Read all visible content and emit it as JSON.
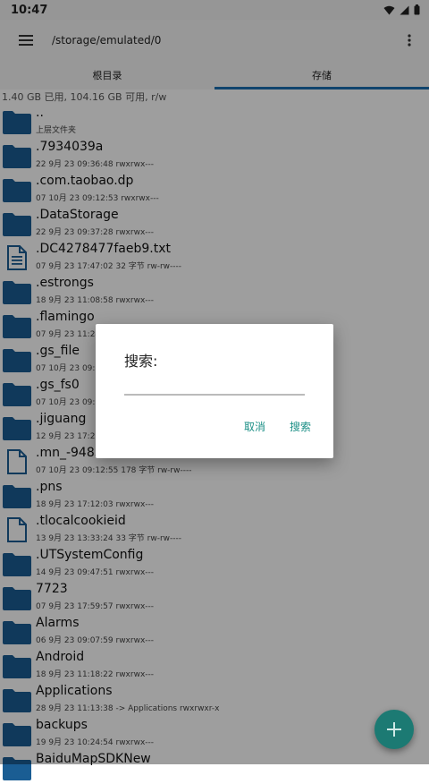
{
  "status_bar": {
    "time": "10:47"
  },
  "app_bar": {
    "path": "/storage/emulated/0"
  },
  "tabs": [
    {
      "label": "根目录",
      "active": false
    },
    {
      "label": "存储",
      "active": true
    }
  ],
  "storage_info": "1.40 GB 已用, 104.16 GB 可用, r/w",
  "files": [
    {
      "name": "..",
      "meta": "上层文件夹",
      "type": "folder"
    },
    {
      "name": ".7934039a",
      "meta": "22 9月 23 09:36:48   rwxrwx---",
      "type": "folder"
    },
    {
      "name": ".com.taobao.dp",
      "meta": "07 10月 23 09:12:53   rwxrwx---",
      "type": "folder"
    },
    {
      "name": ".DataStorage",
      "meta": "22 9月 23 09:37:28   rwxrwx---",
      "type": "folder"
    },
    {
      "name": ".DC4278477faeb9.txt",
      "meta": "07 9月 23 17:47:02  32 字节  rw-rw----",
      "type": "text-file"
    },
    {
      "name": ".estrongs",
      "meta": "18 9月 23 11:08:58   rwxrwx---",
      "type": "folder"
    },
    {
      "name": ".flamingo",
      "meta": "07 9月 23 11:24",
      "type": "folder"
    },
    {
      "name": ".gs_file",
      "meta": "07 10月 23 09:1",
      "type": "folder"
    },
    {
      "name": ".gs_fs0",
      "meta": "07 10月 23 09:1",
      "type": "folder"
    },
    {
      "name": ".jiguang",
      "meta": "12 9月 23 17:21",
      "type": "folder"
    },
    {
      "name": ".mn_-9485",
      "meta": "07 10月 23 09:12:55  178 字节  rw-rw----",
      "type": "file"
    },
    {
      "name": ".pns",
      "meta": "18 9月 23 17:12:03   rwxrwx---",
      "type": "folder"
    },
    {
      "name": ".tlocalcookieid",
      "meta": "13 9月 23 13:33:24  33 字节  rw-rw----",
      "type": "file"
    },
    {
      "name": ".UTSystemConfig",
      "meta": "14 9月 23 09:47:51   rwxrwx---",
      "type": "folder"
    },
    {
      "name": "7723",
      "meta": "07 9月 23 17:59:57   rwxrwx---",
      "type": "folder"
    },
    {
      "name": "Alarms",
      "meta": "06 9月 23 09:07:59   rwxrwx---",
      "type": "folder"
    },
    {
      "name": "Android",
      "meta": "18 9月 23 11:18:22   rwxrwx---",
      "type": "folder"
    },
    {
      "name": "Applications",
      "meta": "28 9月 23 11:13:38  -> Applications  rwxrwxr-x",
      "type": "folder"
    },
    {
      "name": "backups",
      "meta": "19 9月 23 10:24:54   rwxrwx---",
      "type": "folder"
    },
    {
      "name": "BaiduMapSDKNew",
      "meta": "",
      "type": "folder"
    }
  ],
  "dialog": {
    "title": "搜索:",
    "input_value": "",
    "cancel_label": "取消",
    "search_label": "搜索"
  },
  "colors": {
    "accent": "#1b8f86",
    "folder": "#1a5d93",
    "fab": "#1c7a73",
    "tab_indicator": "#1b6fb1"
  }
}
